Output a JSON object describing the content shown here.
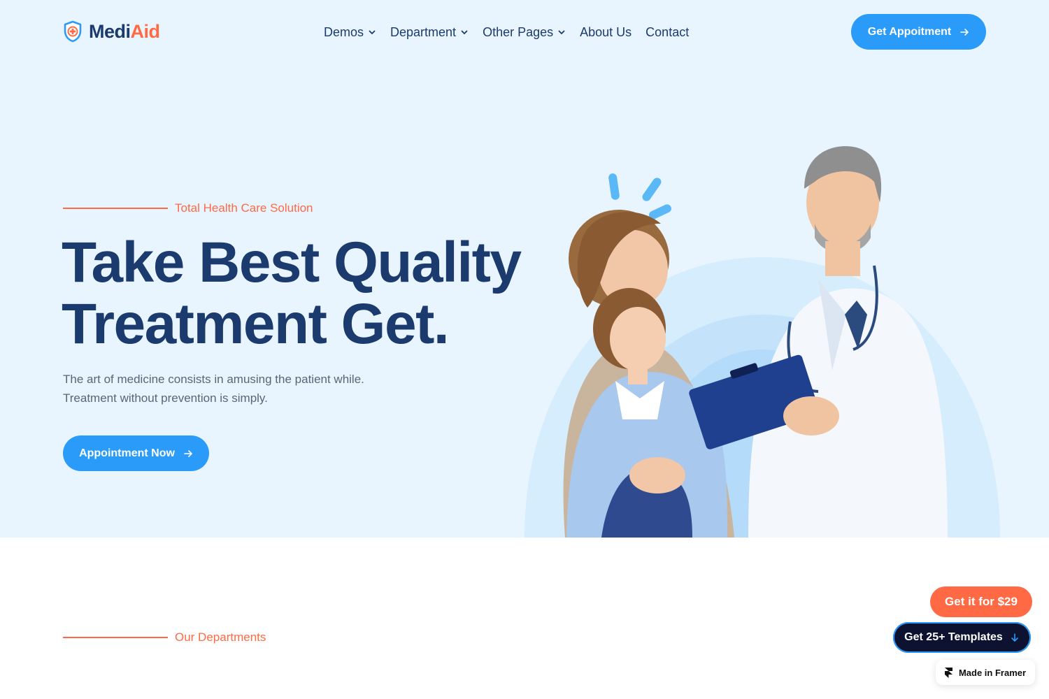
{
  "header": {
    "logo": {
      "text_main": "Medi",
      "text_accent": "Aid",
      "icon": "shield-cross-icon"
    },
    "nav": [
      {
        "label": "Demos",
        "has_dropdown": true
      },
      {
        "label": "Department",
        "has_dropdown": true
      },
      {
        "label": "Other Pages",
        "has_dropdown": true
      },
      {
        "label": "About Us",
        "has_dropdown": false
      },
      {
        "label": "Contact",
        "has_dropdown": false
      }
    ],
    "cta_label": "Get Appoitment"
  },
  "hero": {
    "eyebrow": "Total Health Care Solution",
    "title_line1": "Take Best Quality",
    "title_line2": "Treatment Get.",
    "description": "The art of medicine consists in amusing the patient while. Treatment without prevention is simply.",
    "cta_label": "Appointment Now",
    "image": "doctor-with-mother-and-daughter-photo"
  },
  "departments": {
    "eyebrow": "Our Departments"
  },
  "floating": {
    "price_label": "Get it for $29",
    "templates_label": "Get 25+ Templates",
    "framer_label": "Made in Framer"
  },
  "colors": {
    "primary_blue": "#2a9bf9",
    "navy": "#1b3a6d",
    "accent_orange": "#ff6a45",
    "hero_bg": "#e9f5fe",
    "dark_button": "#0c1230"
  }
}
